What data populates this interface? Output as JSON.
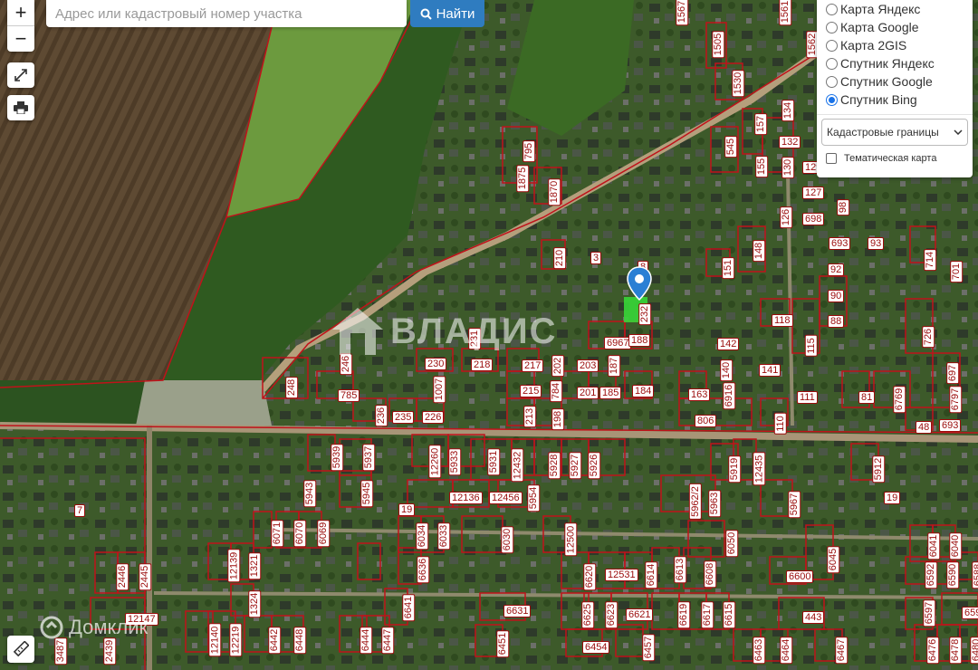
{
  "search": {
    "placeholder": "Адрес или кадастровый номер участка",
    "button_label": "Найти"
  },
  "zoom": {
    "in_label": "+",
    "out_label": "−"
  },
  "layers": {
    "options": [
      "Карта Яндекс",
      "Карта Google",
      "Карта 2GIS",
      "Спутник Яндекс",
      "Спутник Google",
      "Спутник Bing"
    ],
    "selected_index": 5,
    "select_value": "Кадастровые границы",
    "thematic_label": "Тематическая карта",
    "thematic_checked": false
  },
  "watermarks": {
    "vladis": "ВЛАДИС",
    "domclick": "Домклик"
  },
  "marker_parcel": "232",
  "parcel_labels": [
    "1567",
    "1561",
    "1505",
    "1530",
    "1562",
    "795",
    "1875",
    "1870",
    "210",
    "3",
    "8",
    "232",
    "6967",
    "188",
    "545",
    "157",
    "134",
    "132",
    "155",
    "130",
    "129",
    "127",
    "98",
    "126",
    "698",
    "693",
    "93",
    "714",
    "701",
    "151",
    "148",
    "92",
    "90",
    "88",
    "118",
    "115",
    "726",
    "142",
    "140",
    "141",
    "6916",
    "111",
    "81",
    "6769",
    "6797",
    "697",
    "163",
    "806",
    "110",
    "48",
    "693",
    "231",
    "246",
    "248",
    "230",
    "218",
    "217",
    "202",
    "203",
    "187",
    "785",
    "1007",
    "215",
    "784",
    "201",
    "185",
    "184",
    "236",
    "235",
    "226",
    "213",
    "198",
    "5939",
    "5937",
    "12260",
    "5933",
    "5931",
    "12432",
    "5928",
    "5927",
    "5926",
    "5919",
    "12435",
    "5912",
    "5943",
    "5945",
    "19",
    "12136",
    "12456",
    "5954",
    "5962/2",
    "5963",
    "5967",
    "19",
    "7",
    "6071",
    "6070",
    "6069",
    "6034",
    "6033",
    "6030",
    "12500",
    "6050",
    "6045",
    "6041",
    "6040",
    "12139",
    "1321",
    "6636",
    "6620",
    "12531",
    "6614",
    "6613",
    "6608",
    "6600",
    "6592",
    "6590",
    "6588",
    "2446",
    "2445",
    "1324",
    "6641",
    "6631",
    "6625",
    "6623",
    "6621",
    "6619",
    "6617",
    "6615",
    "443",
    "6597",
    "6591",
    "12147",
    "12140",
    "12219",
    "6442",
    "6448",
    "6444",
    "6447",
    "6451",
    "6454",
    "6457",
    "6463",
    "6464",
    "6467",
    "6476",
    "6478",
    "6480",
    "3487",
    "2439"
  ]
}
